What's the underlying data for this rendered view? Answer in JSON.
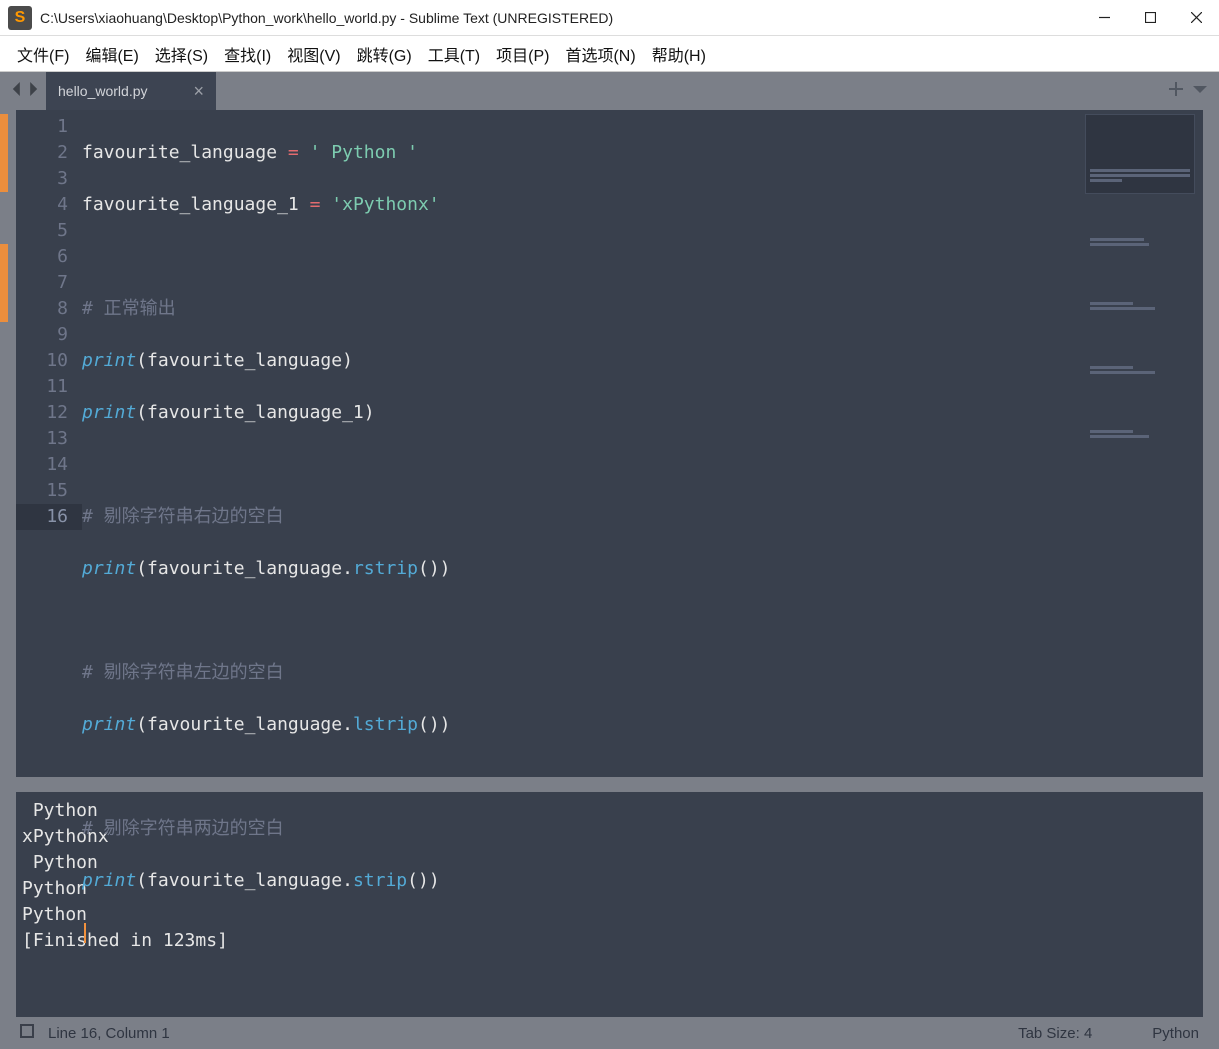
{
  "titlebar": {
    "path": "C:\\Users\\xiaohuang\\Desktop\\Python_work\\hello_world.py - Sublime Text (UNREGISTERED)"
  },
  "menu": {
    "file": "文件(F)",
    "edit": "编辑(E)",
    "select": "选择(S)",
    "find": "查找(I)",
    "view": "视图(V)",
    "goto": "跳转(G)",
    "tools": "工具(T)",
    "project": "项目(P)",
    "prefs": "首选项(N)",
    "help": "帮助(H)"
  },
  "tab": {
    "name": "hello_world.py"
  },
  "code": {
    "l1_var": "favourite_language",
    "l1_eq": " = ",
    "l1_str": "' Python '",
    "l2_var": "favourite_language_1",
    "l2_eq": " = ",
    "l2_str": "'xPythonx'",
    "l4_cmt": "# 正常输出",
    "l5_fn": "print",
    "l5_arg": "favourite_language",
    "l6_fn": "print",
    "l6_arg": "favourite_language_1",
    "l8_cmt": "# 剔除字符串右边的空白",
    "l9_fn": "print",
    "l9_arg": "favourite_language",
    "l9_m": "rstrip",
    "l11_cmt": "# 剔除字符串左边的空白",
    "l12_fn": "print",
    "l12_arg": "favourite_language",
    "l12_m": "lstrip",
    "l14_cmt": "# 剔除字符串两边的空白",
    "l15_fn": "print",
    "l15_arg": "favourite_language",
    "l15_m": "strip"
  },
  "line_numbers": [
    "1",
    "2",
    "3",
    "4",
    "5",
    "6",
    "7",
    "8",
    "9",
    "10",
    "11",
    "12",
    "13",
    "14",
    "15",
    "16"
  ],
  "output": {
    "l1": " Python ",
    "l2": "xPythonx",
    "l3": " Python",
    "l4": "Python ",
    "l5": "Python",
    "l6": "[Finished in 123ms]"
  },
  "status": {
    "pos": "Line 16, Column 1",
    "tab": "Tab Size: 4",
    "lang": "Python"
  }
}
